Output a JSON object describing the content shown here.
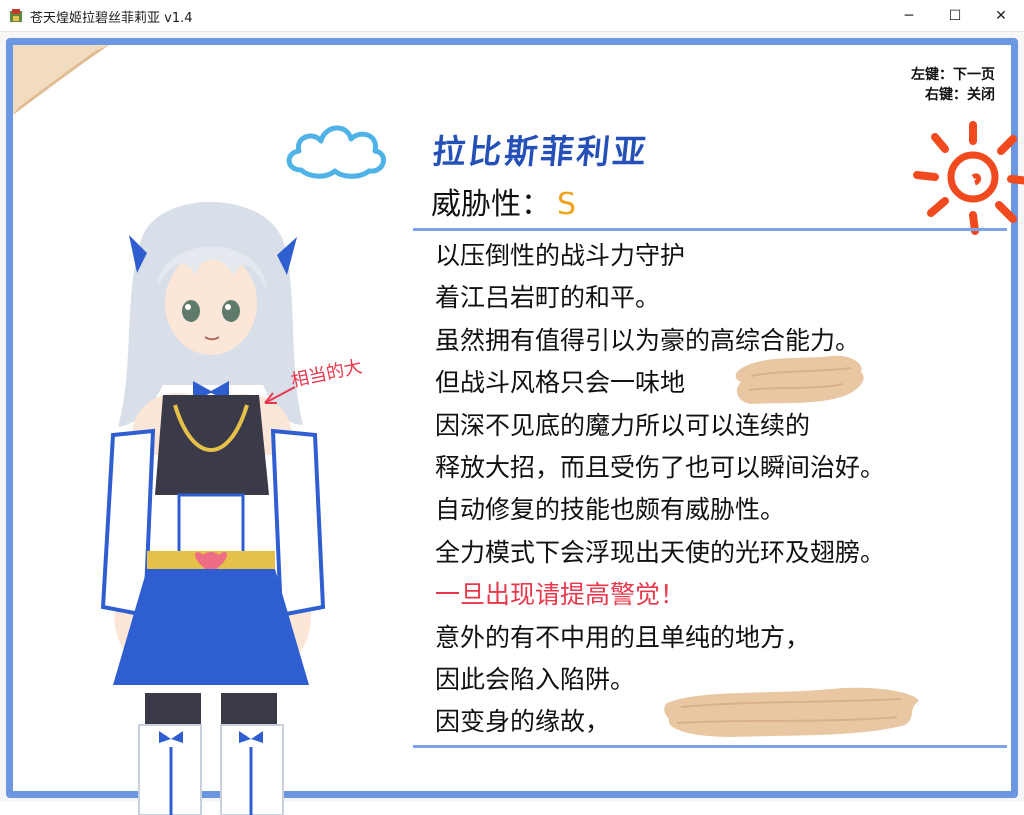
{
  "window": {
    "title": "苍天煌姬拉碧丝菲莉亚 v1.4",
    "minimize_glyph": "─",
    "maximize_glyph": "☐",
    "close_glyph": "✕"
  },
  "hints": {
    "left_click": "左键：下一页",
    "right_click": "右键：关闭"
  },
  "profile": {
    "name": "拉比斯菲利亚",
    "threat_label": "威胁性：",
    "threat_value": "S",
    "side_note": "相当的大",
    "lines": [
      "以压倒性的战斗力守护",
      "着江吕岩町的和平。",
      "虽然拥有值得引以为豪的高综合能力。",
      "但战斗风格只会一味地",
      "因深不见底的魔力所以可以连续的",
      "释放大招，而且受伤了也可以瞬间治好。",
      "自动修复的技能也颇有威胁性。",
      "全力模式下会浮现出天使的光环及翅膀。",
      "一旦出现请提高警觉！",
      "意外的有不中用的且单纯的地方，",
      "因此会陷入陷阱。",
      "因变身的缘故，"
    ]
  },
  "colors": {
    "frame": "#6b96e2",
    "name": "#2450b8",
    "threat": "#f0a21a",
    "warning": "#e8384b",
    "cloud": "#4fb3e8",
    "sun": "#f04a1e"
  },
  "icons": [
    "app-icon",
    "cloud-doodle",
    "sun-doodle",
    "page-curl"
  ]
}
